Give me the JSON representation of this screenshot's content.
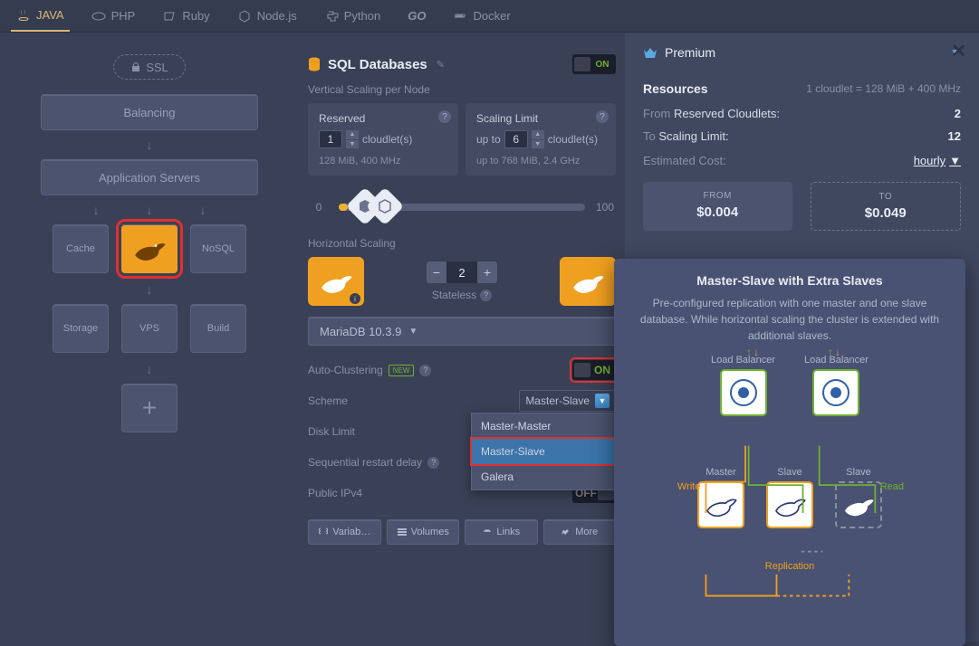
{
  "tabs": [
    "JAVA",
    "PHP",
    "Ruby",
    "Node.js",
    "Python",
    "GO",
    "Docker"
  ],
  "left": {
    "ssl": "SSL",
    "balancing": "Balancing",
    "appservers": "Application Servers",
    "tiles": {
      "cache": "Cache",
      "nosql": "NoSQL",
      "storage": "Storage",
      "vps": "VPS",
      "build": "Build"
    }
  },
  "mid": {
    "section_title": "SQL Databases",
    "on": "ON",
    "off": "OFF",
    "vscaling": "Vertical Scaling per Node",
    "reserved": {
      "title": "Reserved",
      "value": "1",
      "unit": "cloudlet(s)",
      "sub": "128 MiB, 400 MHz"
    },
    "limit": {
      "title": "Scaling Limit",
      "prefix": "up to",
      "value": "6",
      "unit": "cloudlet(s)",
      "sub": "up to 768 MiB, 2.4 GHz"
    },
    "slider": {
      "min": "0",
      "max": "100"
    },
    "hscaling": "Horizontal Scaling",
    "hs_value": "2",
    "stateless": "Stateless",
    "version": "MariaDB 10.3.9",
    "auto_clustering": "Auto-Clustering",
    "new": "NEW",
    "scheme": "Scheme",
    "scheme_value": "Master-Slave",
    "scheme_options": [
      "Master-Master",
      "Master-Slave",
      "Galera"
    ],
    "disk": "Disk Limit",
    "seq_restart": "Sequential restart delay",
    "ipv4": "Public IPv4",
    "btns": {
      "vars": "Variab…",
      "vols": "Volumes",
      "links": "Links",
      "more": "More"
    }
  },
  "right": {
    "premium": "Premium",
    "resources": "Resources",
    "cloudlet_eq": "1 cloudlet = 128 MiB + 400 MHz",
    "from_lbl": "From",
    "reserved_lbl": "Reserved Cloudlets:",
    "reserved_val": "2",
    "to_lbl": "To",
    "limit_lbl": "Scaling Limit:",
    "limit_val": "12",
    "cost_lbl": "Estimated Cost:",
    "hourly": "hourly",
    "from": "FROM",
    "from_val": "$0.004",
    "to": "TO",
    "to_val": "$0.049"
  },
  "tooltip": {
    "title": "Master-Slave with Extra Slaves",
    "body": "Pre-configured replication with one master and one slave database. While horizontal scaling the cluster is extended with additional slaves.",
    "lb": "Load Balancer",
    "master": "Master",
    "slave": "Slave",
    "write": "Write",
    "read": "Read",
    "replication": "Replication"
  }
}
